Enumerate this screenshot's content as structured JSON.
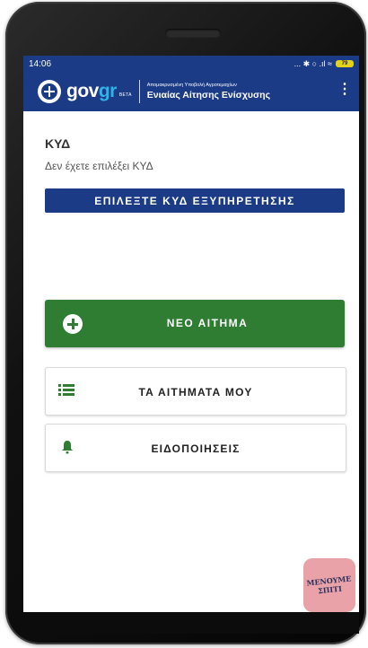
{
  "status_bar": {
    "time": "14:06",
    "indicators": "... ✱ ○ .ıl ≈",
    "battery_label": "79"
  },
  "app_bar": {
    "logo_gov": "gov",
    "logo_gr": "gr",
    "logo_beta": "BETA",
    "subtitle": "Απομακρυσμένη Υποβολή Αγροτεμαχίων",
    "title": "Ενιαίας Αίτησης Ενίσχυσης",
    "menu_icon": "kebab-menu-icon"
  },
  "kyd": {
    "heading": "ΚΥΔ",
    "status": "Δεν έχετε επιλέξει ΚΥΔ",
    "select_button": "ΕΠΙΛΕΞΤΕ ΚΥΔ ΕΞΥΠΗΡΕΤΗΣΗΣ"
  },
  "actions": {
    "new_request": {
      "label": "ΝΕΟ ΑΙΤΗΜΑ",
      "icon": "plus-circle-icon"
    },
    "my_requests": {
      "label": "ΤΑ ΑΙΤΗΜΑΤΑ ΜΟΥ",
      "icon": "list-icon"
    },
    "notifications": {
      "label": "ΕΙΔΟΠΟΙΗΣΕΙΣ",
      "icon": "bell-icon"
    }
  },
  "badge": {
    "line1": "ΜΕΝΟΥΜΕ",
    "line2": "ΣΠΙΤΙ"
  },
  "colors": {
    "brand_blue": "#1b3b87",
    "accent_green": "#2e7d32",
    "logo_light_blue": "#2fb3ea"
  }
}
